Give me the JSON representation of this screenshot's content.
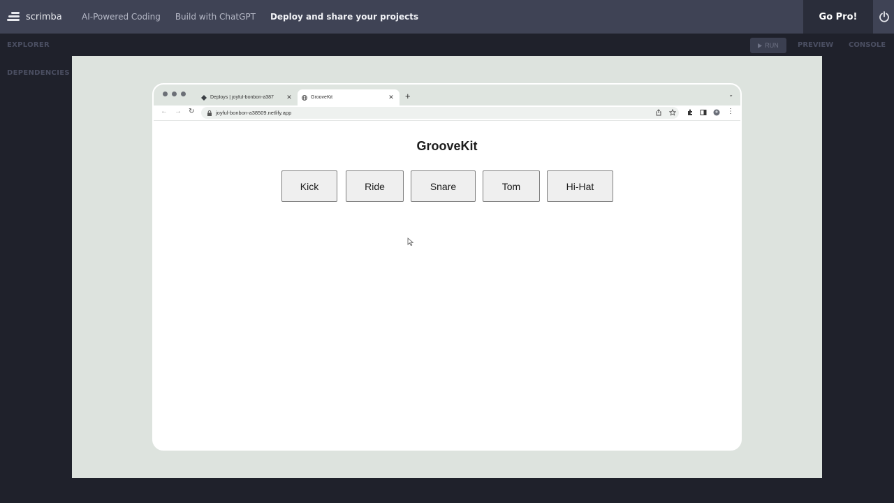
{
  "topbar": {
    "logo_text": "scrimba",
    "breadcrumbs": [
      "AI-Powered Coding",
      "Build with ChatGPT",
      "Deploy and share your projects"
    ],
    "go_pro": "Go Pro!"
  },
  "sidebar": {
    "explorer": "EXPLORER",
    "dependencies": "DEPENDENCIES"
  },
  "panel": {
    "run_label": "RUN",
    "preview_label": "PREVIEW",
    "console_label": "CONSOLE"
  },
  "browser": {
    "tabs": [
      {
        "title": "Deploys | joyful-bonbon-a387",
        "active": false
      },
      {
        "title": "GrooveKit",
        "active": true
      }
    ],
    "new_tab": "+",
    "url": "joyful-bonbon-a38509.netlify.app"
  },
  "app": {
    "title": "GrooveKit",
    "pads": [
      "Kick",
      "Ride",
      "Snare",
      "Tom",
      "Hi-Hat"
    ]
  },
  "colors": {
    "topbar": "#3f4355",
    "background": "#1f212b",
    "preview": "#dde3de",
    "pad": "#efefef"
  }
}
